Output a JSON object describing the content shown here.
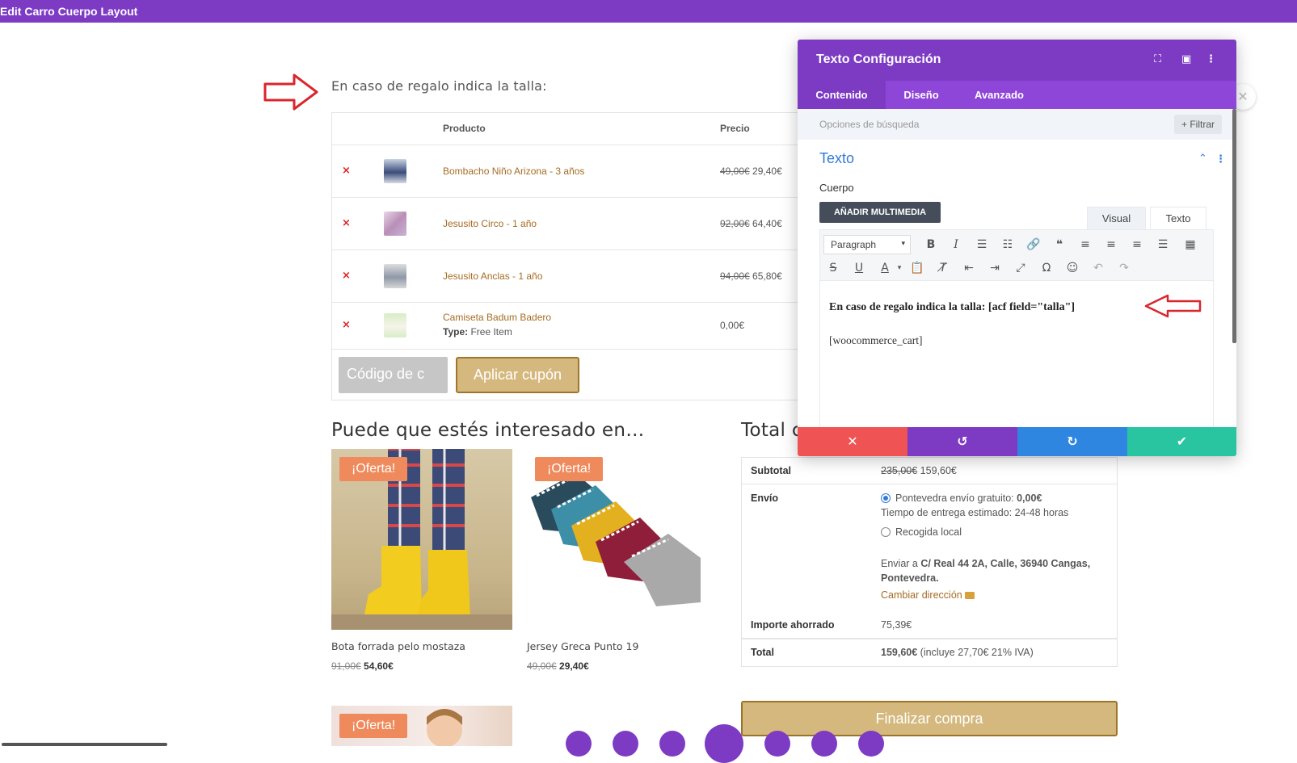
{
  "window": {
    "title": "Edit Carro Cuerpo Layout"
  },
  "page": {
    "heading": "En caso de regalo indica la talla:",
    "cart": {
      "columns": {
        "product": "Producto",
        "price": "Precio"
      },
      "items": [
        {
          "name": "Bombacho Niño Arizona - 3 años",
          "old_price": "49,00€",
          "price": "29,40€",
          "meta_label": "",
          "meta_value": ""
        },
        {
          "name": "Jesusito Circo - 1 año",
          "old_price": "92,00€",
          "price": "64,40€",
          "meta_label": "",
          "meta_value": ""
        },
        {
          "name": "Jesusito Anclas - 1 año",
          "old_price": "94,00€",
          "price": "65,80€",
          "meta_label": "",
          "meta_value": ""
        },
        {
          "name": "Camiseta Badum Badero",
          "old_price": "",
          "price": "0,00€",
          "meta_label": "Type:",
          "meta_value": "Free Item"
        }
      ],
      "remove_icon": "×",
      "coupon_placeholder": "Código de c",
      "coupon_button": "Aplicar cupón"
    },
    "related": {
      "title": "Puede que estés interesado en…",
      "badge": "¡Oferta!",
      "products": [
        {
          "name": "Bota forrada pelo mostaza",
          "old_price": "91,00€",
          "price": "54,60€"
        },
        {
          "name": "Jersey Greca Punto 19",
          "old_price": "49,00€",
          "price": "29,40€"
        }
      ],
      "third_badge": "¡Oferta!"
    },
    "totals": {
      "title": "Total c",
      "subtotal_label": "Subtotal",
      "subtotal_old": "235,00€",
      "subtotal": "159,60€",
      "shipping_label": "Envío",
      "shipping_option1": "Pontevedra envío gratuito:",
      "shipping_option1_price": "0,00€",
      "shipping_eta": "Tiempo de entrega estimado: 24-48 horas",
      "shipping_option2": "Recogida local",
      "ship_to_prefix": "Enviar a",
      "ship_to_address": "C/ Real 44 2A, Calle, 36940 Cangas, Pontevedra.",
      "change_address": "Cambiar dirección",
      "saved_label": "Importe ahorrado",
      "saved_value": "75,39€",
      "total_label": "Total",
      "total_value": "159,60€",
      "total_tax": "(incluye 27,70€ 21% IVA)",
      "checkout_button": "Finalizar compra"
    }
  },
  "modal": {
    "title": "Texto Configuración",
    "tabs": [
      "Contenido",
      "Diseño",
      "Avanzado"
    ],
    "search_placeholder": "Opciones de búsqueda",
    "filter_button": "+ Filtrar",
    "section_title": "Texto",
    "body_label": "Cuerpo",
    "add_media": "AÑADIR MULTIMEDIA",
    "editor_tabs": [
      "Visual",
      "Texto"
    ],
    "format_select": "Paragraph",
    "content_line1": "En caso de regalo indica la talla: [acf field=\"talla\"]",
    "content_line2": "[woocommerce_cart]",
    "footer_icons": [
      "close-icon",
      "undo-icon",
      "redo-icon",
      "check-icon"
    ],
    "footer_colors": [
      "#ef5353",
      "#7d3bc4",
      "#2f86e0",
      "#29c4a0"
    ]
  },
  "colors": {
    "brand_purple": "#7d3bc4",
    "product_link": "#a56c23",
    "gold_button": "#d4b87d",
    "offer_badge": "#ef8a5c",
    "annotation_arrow": "#d9262c"
  }
}
